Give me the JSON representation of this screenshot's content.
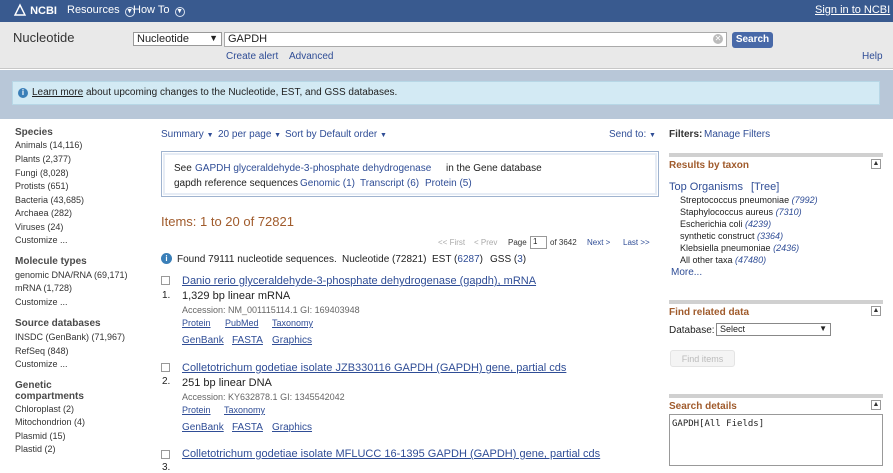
{
  "topbar": {
    "logo_text": "NCBI",
    "resources": "Resources",
    "howto": "How To",
    "signin": "Sign in to NCBI"
  },
  "search": {
    "db_title": "Nucleotide",
    "db_select": "Nucleotide",
    "query": "GAPDH",
    "button": "Search",
    "create_alert": "Create alert",
    "advanced": "Advanced",
    "help": "Help"
  },
  "banner": {
    "link": "Learn more",
    "text": "about upcoming changes to the Nucleotide, EST, and GSS databases."
  },
  "sidebar": {
    "species_h": "Species",
    "species": [
      "Animals (14,116)",
      "Plants (2,377)",
      "Fungi (8,028)",
      "Protists (651)",
      "Bacteria (43,685)",
      "Archaea (282)",
      "Viruses (24)"
    ],
    "species_customize": "Customize ...",
    "moltype_h": "Molecule types",
    "moltype": [
      "genomic DNA/RNA (69,171)",
      "mRNA (1,728)"
    ],
    "moltype_customize": "Customize ...",
    "source_h": "Source databases",
    "source": [
      "INSDC (GenBank) (71,967)",
      "RefSeq (848)"
    ],
    "source_customize": "Customize ...",
    "genetic_h1": "Genetic",
    "genetic_h2": "compartments",
    "genetic": [
      "Chloroplast (2)",
      "Mitochondrion (4)",
      "Plasmid (15)",
      "Plastid (2)"
    ]
  },
  "toolbar": {
    "summary": "Summary",
    "per_page": "20 per page",
    "sort": "Sort by Default order",
    "send_to": "Send to:"
  },
  "gene_box": {
    "see": "See",
    "gene_link": "GAPDH glyceraldehyde-3-phosphate dehydrogenase",
    "in_gene": "in the Gene database",
    "refseq_label": "gapdh reference sequences",
    "genomic": "Genomic (1)",
    "transcript": "Transcript (6)",
    "protein": "Protein (5)"
  },
  "items": {
    "heading": "Items: 1 to 20 of 72821"
  },
  "pager": {
    "first": "<< First",
    "prev": "< Prev",
    "page_label": "Page",
    "page_value": "1",
    "of_pages": "of 3642",
    "next": "Next >",
    "last": "Last >>"
  },
  "found": {
    "text": "Found 79111 nucleotide sequences.",
    "nucleotide": "Nucleotide (72821)",
    "est_label": "EST (",
    "est_count": "6287",
    "est_close": ")",
    "gss_label": "GSS (",
    "gss_count": "3",
    "gss_close": ")"
  },
  "results": [
    {
      "num": "1.",
      "title": "Danio rerio glyceraldehyde-3-phosphate dehydrogenase (gapdh), mRNA",
      "desc": "1,329 bp linear mRNA",
      "accession": "Accession: NM_001115114.1    GI: 169403948",
      "links1": [
        "Protein",
        "PubMed",
        "Taxonomy"
      ],
      "links2": [
        "GenBank",
        "FASTA",
        "Graphics"
      ]
    },
    {
      "num": "2.",
      "title": "Colletotrichum godetiae isolate JZB330116 GAPDH (GAPDH) gene, partial cds",
      "desc": "251 bp linear DNA",
      "accession": "Accession: KY632878.1    GI: 1345542042",
      "links1": [
        "Protein",
        "Taxonomy"
      ],
      "links2": [
        "GenBank",
        "FASTA",
        "Graphics"
      ]
    },
    {
      "num": "3.",
      "title": "Colletotrichum godetiae isolate MFLUCC 16-1395 GAPDH (GAPDH) gene, partial cds"
    }
  ],
  "right": {
    "filters_label": "Filters:",
    "manage_filters": "Manage Filters",
    "taxon_h": "Results by taxon",
    "top_orgs": "Top Organisms",
    "tree": "[Tree]",
    "orgs": [
      {
        "name": "Streptococcus pneumoniae",
        "count": "(7992)"
      },
      {
        "name": "Staphylococcus aureus",
        "count": "(7310)"
      },
      {
        "name": "Escherichia coli",
        "count": "(4239)"
      },
      {
        "name": "synthetic construct",
        "count": "(3364)"
      },
      {
        "name": "Klebsiella pneumoniae",
        "count": "(2436)"
      },
      {
        "name": "All other taxa",
        "count": "(47480)"
      }
    ],
    "more": "More...",
    "related_h": "Find related data",
    "database_label": "Database:",
    "database_select": "Select",
    "find_items": "Find items",
    "details_h": "Search details",
    "details_text": "GAPDH[All Fields]"
  },
  "colors": {
    "topbar": "#395a8f",
    "accent_orange": "#a05b2c",
    "link": "#2f4d96",
    "search_button": "#4869a8"
  }
}
